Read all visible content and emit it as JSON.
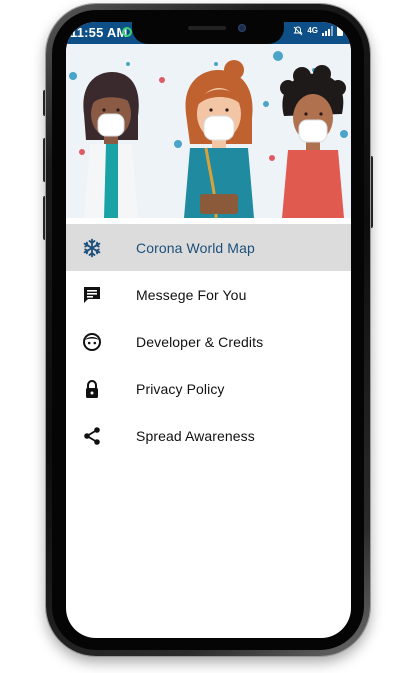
{
  "status_bar": {
    "time": "11:55 AM",
    "network": "4G",
    "background_color": "#0d4f86"
  },
  "colors": {
    "accent": "#1d4f7a",
    "active_row": "#dcdcdc"
  },
  "drawer": {
    "selected_index": 0,
    "items": [
      {
        "label": "Corona World Map",
        "icon": "snowflake-icon"
      },
      {
        "label": "Messege For You",
        "icon": "message-icon"
      },
      {
        "label": "Developer & Credits",
        "icon": "face-icon"
      },
      {
        "label": "Privacy Policy",
        "icon": "lock-icon"
      },
      {
        "label": "Spread Awareness",
        "icon": "share-icon"
      }
    ]
  }
}
